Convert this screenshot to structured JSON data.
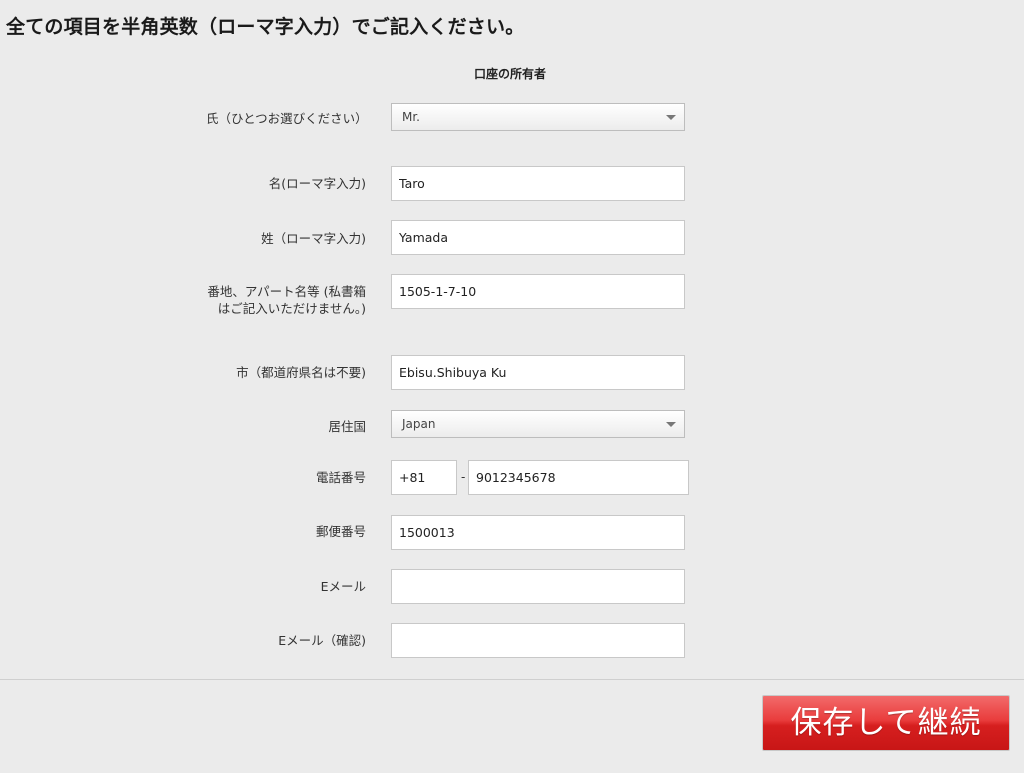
{
  "page": {
    "heading": "全ての項目を半角英数（ローマ字入力）でご記入ください。"
  },
  "form": {
    "section_title": "口座の所有者",
    "title_field": {
      "label": "氏（ひとつお選びください）",
      "value": "Mr."
    },
    "first_name": {
      "label": "名(ローマ字入力)",
      "value": "Taro"
    },
    "last_name": {
      "label": "姓（ローマ字入力)",
      "value": "Yamada"
    },
    "address": {
      "label": "番地、アパート名等 (私書箱はご記入いただけません。)",
      "value": "1505-1-7-10"
    },
    "city": {
      "label": "市（都道府県名は不要)",
      "value": "Ebisu.Shibuya Ku"
    },
    "country": {
      "label": "居住国",
      "value": "Japan"
    },
    "phone": {
      "label": "電話番号",
      "country_code": "+81",
      "separator": "-",
      "number": "9012345678"
    },
    "postal_code": {
      "label": "郵便番号",
      "value": "1500013"
    },
    "email": {
      "label": "Eメール",
      "value": ""
    },
    "email_confirm": {
      "label": "Eメール（確認)",
      "value": ""
    }
  },
  "actions": {
    "save_continue_label": "保存して継続"
  }
}
